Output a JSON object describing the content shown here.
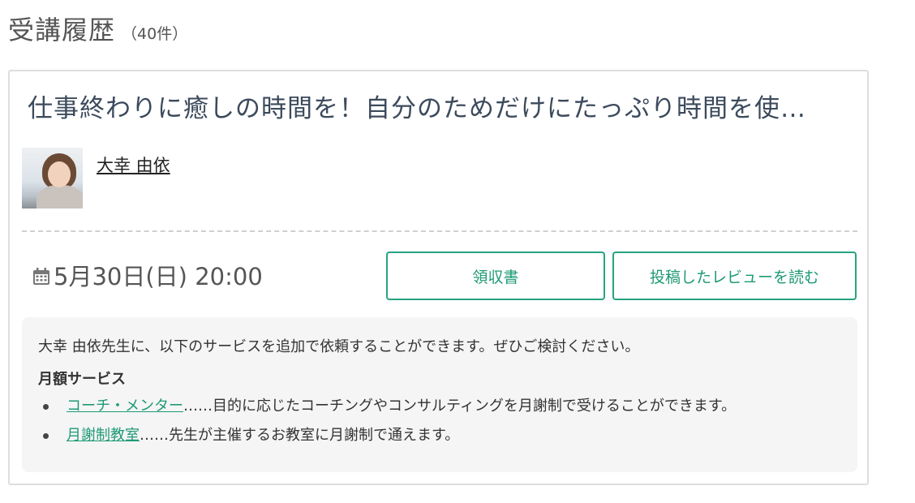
{
  "header": {
    "title": "受講履歴",
    "count": "（40件）"
  },
  "card": {
    "course_title": "仕事終わりに癒しの時間を！自分のためだけにたっぷり時間を使…",
    "teacher_name": "大幸 由依",
    "date": "5月30日(日) 20:00",
    "buttons": {
      "receipt": "領収書",
      "review": "投稿したレビューを読む"
    },
    "info": {
      "intro": "大幸 由依先生に、以下のサービスを追加で依頼することができます。ぜひご検討ください。",
      "heading": "月額サービス",
      "items": [
        {
          "link": "コーチ・メンター",
          "description": "……目的に応じたコーチングやコンサルティングを月謝制で受けることができます。"
        },
        {
          "link": "月謝制教室",
          "description": "……先生が主催するお教室に月謝制で通えます。"
        }
      ]
    }
  },
  "colors": {
    "accent": "#27a380",
    "title": "#3c4a5c",
    "info_bg": "#f5f5f5"
  },
  "icons": {
    "date": "calendar-icon"
  }
}
